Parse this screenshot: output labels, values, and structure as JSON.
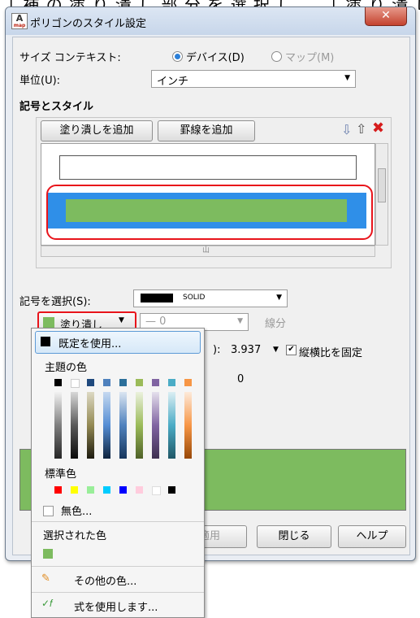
{
  "top_caption": "「 補 の 塗 り 潰 し 部 分 を 選 択 し 、 「 塗 り 潰 し 」",
  "window": {
    "title": "ポリゴンのスタイル設定",
    "icon_letter": "A",
    "icon_sub": "map",
    "close": "✕"
  },
  "size_context": {
    "label": "サイズ コンテキスト:",
    "option_device": "デバイス(D)",
    "option_map": "マップ(M)",
    "selected": "device"
  },
  "unit": {
    "label": "単位(U):",
    "value": "インチ"
  },
  "symbols": {
    "heading": "記号とスタイル",
    "add_fill": "塗り潰しを追加",
    "add_stroke": "罫線を追加",
    "scroll_mark": "山"
  },
  "symbol_select": {
    "label": "記号を選択(S):",
    "value": "SOLID"
  },
  "fill_button": {
    "label": "塗り潰し"
  },
  "stroke_width": {
    "value": "— 0"
  },
  "stroke_label": "線分",
  "size_row": {
    "prefix": "):",
    "value": "3.937",
    "checkbox_label": "縦横比を固定",
    "checked": true
  },
  "angle_value": "0",
  "footer": {
    "apply": "適用",
    "close": "閉じる",
    "help": "ヘルプ"
  },
  "color_menu": {
    "default_item": "既定を使用...",
    "theme_heading": "主題の色",
    "standard_heading": "標準色",
    "no_color": "無色...",
    "selected_heading": "選択された色",
    "more_colors": "その他の色...",
    "use_expression": "式を使用します..."
  },
  "colors": {
    "fill_green": "#7dbb5f",
    "selection_blue": "#2f8fe8",
    "red_outline": "#e8141b",
    "theme_top": [
      "#000000",
      "#ffffff",
      "#1f497d",
      "#4f81bd",
      "#c0504d",
      "#9bbb59",
      "#8064a2",
      "#4bacc6",
      "#f79646"
    ],
    "standard": [
      "#ff0000",
      "#ffff00",
      "#99ee99",
      "#00ccff",
      "#0000ff",
      "#ffccdd",
      "#ffffff",
      "#000000"
    ]
  }
}
